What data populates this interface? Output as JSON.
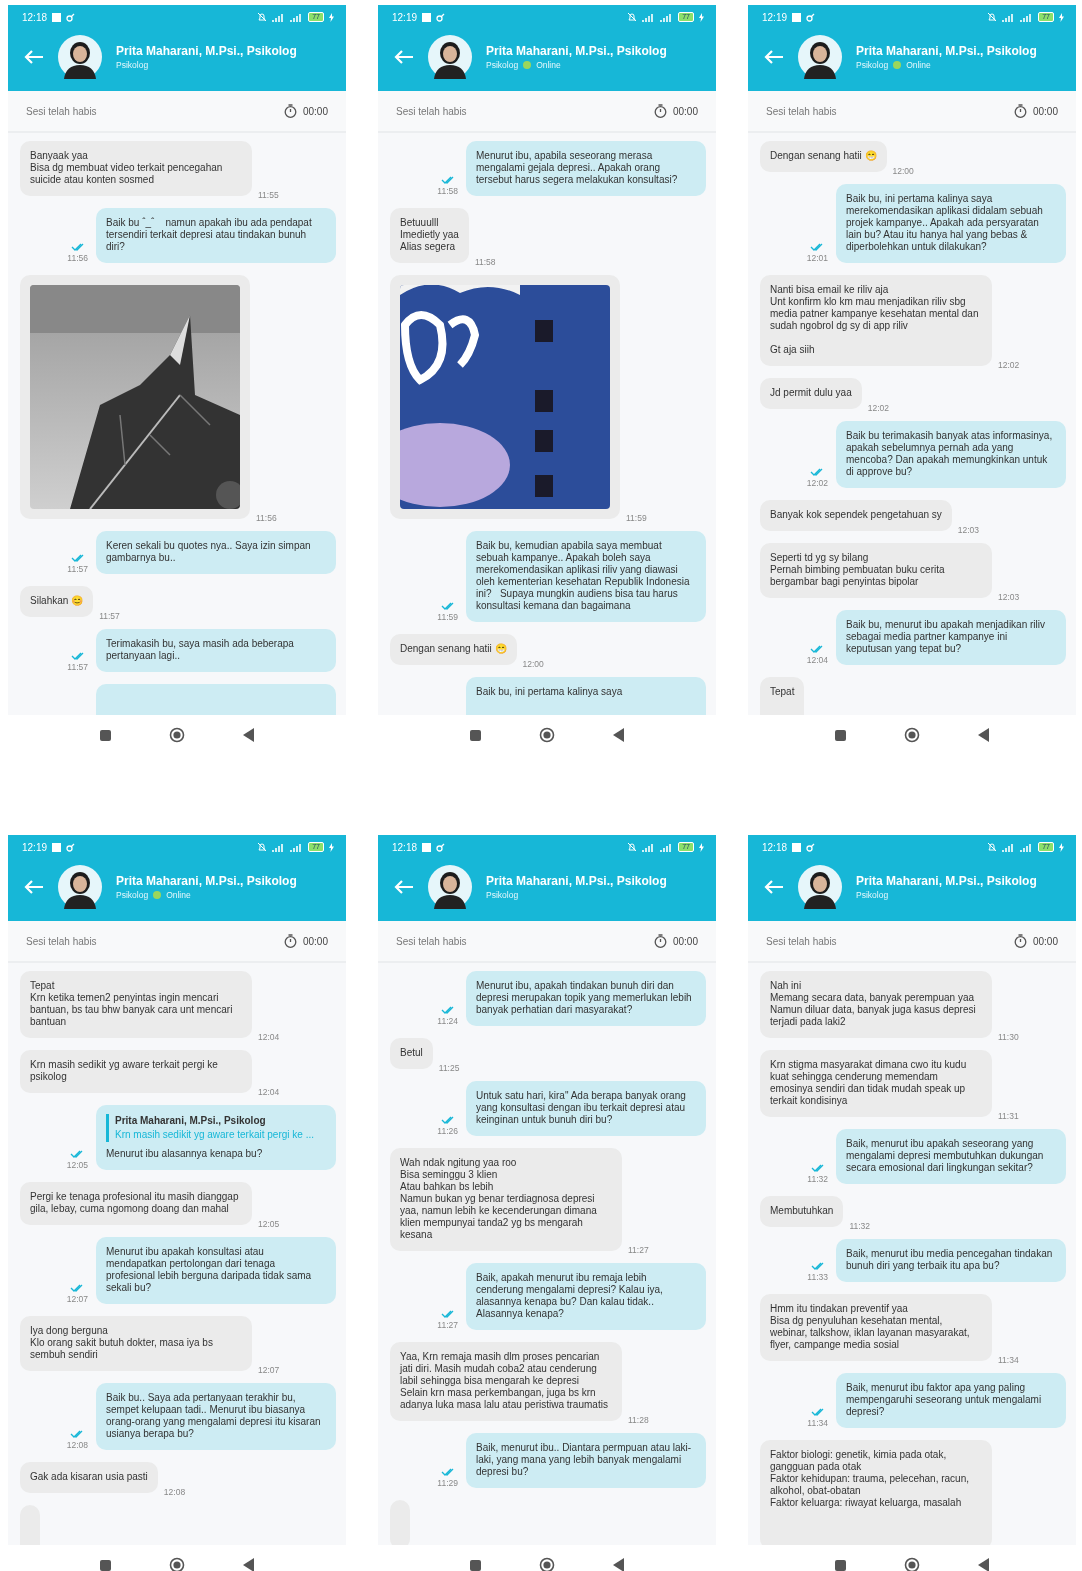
{
  "phones": [
    {
      "status_bar": {
        "time": "12:18",
        "battery": "77"
      },
      "contact": {
        "name": "Prita Maharani, M.Psi., Psikolog",
        "role": "Psikolog"
      },
      "session": {
        "label": "Sesi telah habis",
        "timer": "00:00"
      },
      "messages": [
        {
          "kind": "text",
          "outgoing": false,
          "text": "Banyaak yaa\nBisa dg membuat video terkait pencegahan suicide atau konten sosmed",
          "time": "11:55"
        },
        {
          "kind": "text",
          "outgoing": true,
          "text": "Baik bu ˆ_ˆ    namun apakah ibu ada pendapat tersendiri terkait depresi atau tindakan bunuh diri?",
          "time": "11:56"
        },
        {
          "outgoing": false,
          "time": "11:56"
        },
        {
          "kind": "text",
          "outgoing": true,
          "text": "Keren sekali bu quotes nya.. Saya izin simpan gambarnya bu..",
          "time": "11:57"
        },
        {
          "kind": "text",
          "outgoing": false,
          "text": "Silahkan 😊",
          "time": "11:57"
        },
        {
          "kind": "text",
          "outgoing": true,
          "text": "Terimakasih bu, saya masih ada beberapa pertanyaan lagi..",
          "time": "11:57"
        },
        {
          "kind": "text",
          "outgoing": true
        }
      ]
    },
    {
      "status_bar": {
        "time": "12:19",
        "battery": "77"
      },
      "contact": {
        "name": "Prita Maharani, M.Psi., Psikolog",
        "role": "Psikolog",
        "presence": "Online"
      },
      "session": {
        "label": "Sesi telah habis",
        "timer": "00:00"
      },
      "messages": [
        {
          "kind": "text",
          "outgoing": true,
          "text": "Menurut ibu, apabila seseorang merasa mengalami gejala depresi.. Apakah orang tersebut harus segera melakukan konsultasi?",
          "time": "11:58"
        },
        {
          "kind": "text",
          "outgoing": false,
          "text": "Betuuulll\nImedietly yaa\nAlias segera",
          "time": "11:58"
        },
        {
          "outgoing": false,
          "time": "11:59"
        },
        {
          "kind": "text",
          "outgoing": true,
          "text": "Baik bu, kemudian apabila saya membuat sebuah kampanye.. Apakah boleh saya merekomendasikan aplikasi riliv yang diawasi oleh kementerian kesehatan Republik Indonesia ini?   Supaya mungkin audiens bisa tau harus konsultasi kemana dan bagaimana",
          "time": "11:59"
        },
        {
          "kind": "text",
          "outgoing": false,
          "text": "Dengan senang hatii 😁",
          "time": "12:00"
        },
        {
          "kind": "text",
          "outgoing": true,
          "text": "Baik bu, ini pertama kalinya saya"
        }
      ]
    },
    {
      "status_bar": {
        "time": "12:19",
        "battery": "77"
      },
      "contact": {
        "name": "Prita Maharani, M.Psi., Psikolog",
        "role": "Psikolog",
        "presence": "Online"
      },
      "session": {
        "label": "Sesi telah habis",
        "timer": "00:00"
      },
      "messages": [
        {
          "kind": "text",
          "outgoing": false,
          "text": "Dengan senang hatii 😁",
          "time": "12:00"
        },
        {
          "kind": "text",
          "outgoing": true,
          "text": "Baik bu, ini pertama kalinya saya merekomendasikan aplikasi didalam sebuah projek kampanye.. Apakah ada persyaratan lain bu? Atau itu hanya hal yang bebas & diperbolehkan untuk dilakukan?",
          "time": "12:01"
        },
        {
          "kind": "text",
          "outgoing": false,
          "text": "Nanti bisa email ke riliv aja\nUnt konfirm klo km mau menjadikan riliv sbg media patner kampanye kesehatan mental dan sudah ngobrol dg sy di app riliv\n\nGt aja siih",
          "time": "12:02"
        },
        {
          "kind": "text",
          "outgoing": false,
          "text": "Jd permit dulu yaa",
          "time": "12:02"
        },
        {
          "kind": "text",
          "outgoing": true,
          "text": "Baik bu terimakasih banyak atas informasinya, apakah sebelumnya pernah ada yang mencoba? Dan apakah memungkinkan untuk di approve bu?",
          "time": "12:02"
        },
        {
          "kind": "text",
          "outgoing": false,
          "text": "Banyak kok sependek pengetahuan sy",
          "time": "12:03"
        },
        {
          "kind": "text",
          "outgoing": false,
          "text": "Seperti td yg sy bilang\nPernah bimbing pembuatan buku cerita bergambar bagi penyintas bipolar",
          "time": "12:03"
        },
        {
          "kind": "text",
          "outgoing": true,
          "text": "Baik bu, menurut ibu apakah menjadikan riliv sebagai media partner kampanye ini keputusan yang tepat bu?",
          "time": "12:04"
        },
        {
          "kind": "text",
          "outgoing": false,
          "text": "Tepat"
        }
      ]
    },
    {
      "status_bar": {
        "time": "12:19",
        "battery": "77"
      },
      "contact": {
        "name": "Prita Maharani, M.Psi., Psikolog",
        "role": "Psikolog",
        "presence": "Online"
      },
      "session": {
        "label": "Sesi telah habis",
        "timer": "00:00"
      },
      "messages": [
        {
          "kind": "text",
          "outgoing": false,
          "text": "Tepat\nKrn ketika temen2 penyintas ingin mencari bantuan, bs tau bhw banyak cara unt mencari bantuan",
          "time": "12:04"
        },
        {
          "kind": "text",
          "outgoing": false,
          "text": "Krn masih sedikit yg aware terkait pergi ke psikolog",
          "time": "12:04"
        },
        {
          "kind": "text",
          "outgoing": true,
          "quote": {
            "name": "Prita Maharani, M.Psi., Psikolog",
            "text": "Krn masih sedikit yg aware terkait pergi ke ..."
          },
          "text": "Menurut ibu alasannya kenapa bu?",
          "time": "12:05"
        },
        {
          "kind": "text",
          "outgoing": false,
          "text": "Pergi ke tenaga profesional itu masih dianggap gila, lebay, cuma ngomong doang dan mahal",
          "time": "12:05"
        },
        {
          "kind": "text",
          "outgoing": true,
          "text": "Menurut ibu apakah konsultasi atau mendapatkan pertolongan dari tenaga profesional lebih berguna daripada tidak sama sekali bu?",
          "time": "12:07"
        },
        {
          "kind": "text",
          "outgoing": false,
          "text": "Iya dong berguna\nKlo orang sakit butuh dokter, masa iya bs sembuh sendiri",
          "time": "12:07"
        },
        {
          "kind": "text",
          "outgoing": true,
          "text": "Baik bu.. Saya ada pertanyaan terakhir bu, sempet kelupaan tadi.. Menurut ibu biasanya orang-orang yang mengalami depresi itu kisaran usianya berapa bu?",
          "time": "12:08"
        },
        {
          "kind": "text",
          "outgoing": false,
          "text": "Gak ada kisaran usia pasti",
          "time": "12:08"
        },
        {
          "kind": "text",
          "outgoing": false
        }
      ]
    },
    {
      "status_bar": {
        "time": "12:18",
        "battery": "77"
      },
      "contact": {
        "name": "Prita Maharani, M.Psi., Psikolog",
        "role": "Psikolog"
      },
      "session": {
        "label": "Sesi telah habis",
        "timer": "00:00"
      },
      "messages": [
        {
          "kind": "text",
          "outgoing": true,
          "text": "Menurut ibu, apakah tindakan bunuh diri dan depresi merupakan topik yang memerlukan lebih banyak perhatian dari masyarakat?",
          "time": "11:24"
        },
        {
          "kind": "text",
          "outgoing": false,
          "text": "Betul",
          "time": "11:25"
        },
        {
          "kind": "text",
          "outgoing": true,
          "text": "Untuk satu hari, kira\" Ada berapa banyak orang yang konsultasi dengan ibu terkait depresi atau keinginan untuk bunuh diri bu?",
          "time": "11:26"
        },
        {
          "kind": "text",
          "outgoing": false,
          "text": "Wah ndak ngitung yaa roo\nBisa seminggu 3 klien\nAtau bahkan bs lebih\nNamun bukan yg benar terdiagnosa depresi yaa, namun lebih ke kecenderungan dimana klien mempunyai tanda2 yg bs mengarah kesana",
          "time": "11:27"
        },
        {
          "kind": "text",
          "outgoing": true,
          "text": "Baik, apakah menurut ibu remaja lebih cenderung mengalami depresi? Kalau iya, alasannya kenapa bu? Dan kalau tidak.. Alasannya kenapa?",
          "time": "11:27"
        },
        {
          "kind": "text",
          "outgoing": false,
          "text": "Yaa, Krn remaja masih dlm proses pencarian jati diri. Masih mudah coba2 atau cenderung labil sehingga bisa mengarah ke depresi\nSelain krn masa perkembangan, juga bs krn adanya luka masa lalu atau peristiwa traumatis",
          "time": "11:28"
        },
        {
          "kind": "text",
          "outgoing": true,
          "text": "Baik, menurut ibu.. Diantara permpuan atau laki-laki, yang mana yang lebih banyak mengalami depresi bu?",
          "time": "11:29"
        },
        {
          "kind": "text",
          "outgoing": false
        }
      ]
    },
    {
      "status_bar": {
        "time": "12:18",
        "battery": "77"
      },
      "contact": {
        "name": "Prita Maharani, M.Psi., Psikolog",
        "role": "Psikolog"
      },
      "session": {
        "label": "Sesi telah habis",
        "timer": "00:00"
      },
      "messages": [
        {
          "kind": "text",
          "outgoing": false,
          "text": "Nah ini\nMemang secara data, banyak perempuan yaa\nNamun diluar data, banyak juga kasus depresi terjadi pada laki2",
          "time": "11:30"
        },
        {
          "kind": "text",
          "outgoing": false,
          "text": "Krn stigma masyarakat dimana cwo itu kudu kuat sehingga cenderung memendam emosinya sendiri dan tidak mudah speak up terkait kondisinya",
          "time": "11:31"
        },
        {
          "kind": "text",
          "outgoing": true,
          "text": "Baik, menurut ibu apakah seseorang yang mengalami depresi membutuhkan dukungan secara emosional dari lingkungan sekitar?",
          "time": "11:32"
        },
        {
          "kind": "text",
          "outgoing": false,
          "text": "Membutuhkan",
          "time": "11:32"
        },
        {
          "kind": "text",
          "outgoing": true,
          "text": "Baik, menurut ibu media pencegahan tindakan bunuh diri yang terbaik itu apa bu?",
          "time": "11:33"
        },
        {
          "kind": "text",
          "outgoing": false,
          "text": "Hmm itu tindakan preventif yaa\nBisa dg penyuluhan kesehatan mental, webinar, talkshow, iklan layanan masyarakat, flyer, campange media sosial",
          "time": "11:34"
        },
        {
          "kind": "text",
          "outgoing": true,
          "text": "Baik, menurut ibu faktor apa yang paling mempengaruhi seseorang untuk mengalami depresi?",
          "time": "11:34"
        },
        {
          "kind": "text",
          "outgoing": false,
          "text": "Faktor biologi: genetik, kimia pada otak, gangguan pada otak\nFaktor kehidupan: trauma, pelecehan, racun, alkohol, obat-obatan\nFaktor keluarga: riwayat keluarga, masalah"
        }
      ]
    }
  ]
}
